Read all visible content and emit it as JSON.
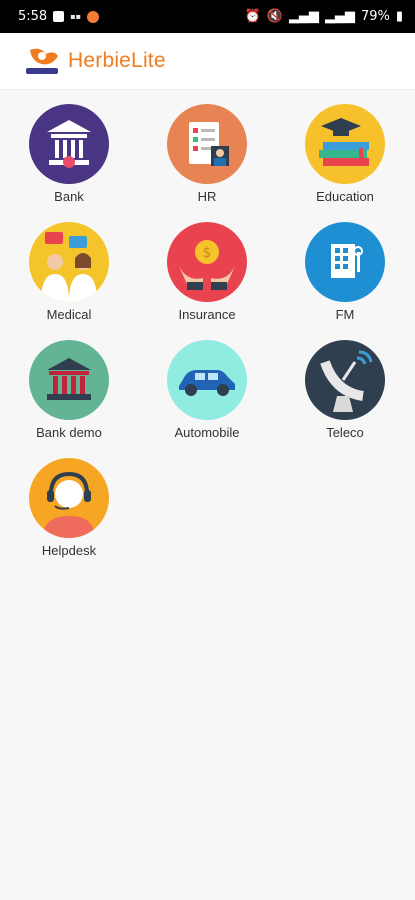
{
  "status_bar": {
    "time": "5:58",
    "battery": "79%",
    "notification_icons": [
      "gallery-icon",
      "network-speed-icon",
      "app-notification-icon"
    ],
    "system_icons": [
      "alarm-icon",
      "mute-icon",
      "signal-icon",
      "signal-icon",
      "battery-icon"
    ]
  },
  "header": {
    "title": "HerbieLite",
    "brand_color": "#ef7d1f"
  },
  "tiles": [
    {
      "label": "Bank",
      "icon": "bank-icon",
      "bg": "#4a3585"
    },
    {
      "label": "HR",
      "icon": "hr-icon",
      "bg": "#e88454"
    },
    {
      "label": "Education",
      "icon": "education-icon",
      "bg": "#f7c12b"
    },
    {
      "label": "Medical",
      "icon": "medical-icon",
      "bg": "#f5c32a"
    },
    {
      "label": "Insurance",
      "icon": "insurance-icon",
      "bg": "#e9434f"
    },
    {
      "label": "FM",
      "icon": "building-icon",
      "bg": "#1e8fd2"
    },
    {
      "label": "Bank demo",
      "icon": "bank-demo-icon",
      "bg": "#62b494"
    },
    {
      "label": "Automobile",
      "icon": "car-icon",
      "bg": "#90ebe0"
    },
    {
      "label": "Teleco",
      "icon": "satellite-dish-icon",
      "bg": "#2f3f4f"
    },
    {
      "label": "Helpdesk",
      "icon": "helpdesk-icon",
      "bg": "#f6a623"
    }
  ]
}
